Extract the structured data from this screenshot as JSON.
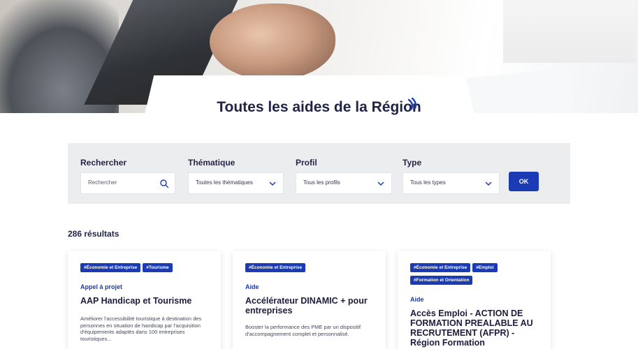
{
  "page": {
    "title": "Toutes les aides de la Région"
  },
  "filters": {
    "search": {
      "label": "Rechercher",
      "placeholder": "Rechercher"
    },
    "thematique": {
      "label": "Thématique",
      "selected": "Toutes les thématiques"
    },
    "profil": {
      "label": "Profil",
      "selected": "Tous les profils"
    },
    "type": {
      "label": "Type",
      "selected": "Tous les types"
    },
    "ok_label": "OK"
  },
  "results": {
    "count_label": "286 résultats"
  },
  "cards": [
    {
      "tags": [
        "#Économie et Entreprise",
        "#Tourisme"
      ],
      "type": "Appel à projet",
      "title": "AAP Handicap et Tourisme",
      "description": "Améliorer l'accessibilité touristique à destination des personnes en situation de handicap par l'acquisition d'équipements adaptés dans 100 entreprises touristiques..."
    },
    {
      "tags": [
        "#Économie et Entreprise"
      ],
      "type": "Aide",
      "title": "Accélérateur DINAMIC + pour entreprises",
      "description": "Booster la performance des PME par un dispositif d'accompagnement complet et personnalisé."
    },
    {
      "tags": [
        "#Économie et Entreprise",
        "#Emploi",
        "#Formation et Orientation"
      ],
      "type": "Aide",
      "title": "Accès Emploi - ACTION DE FORMATION PREALABLE AU RECRUTEMENT (AFPR) - Région Formation",
      "description": ""
    }
  ],
  "colors": {
    "accent": "#1a3bb3",
    "title": "#1f2347",
    "filter_bg": "#ecedef"
  }
}
